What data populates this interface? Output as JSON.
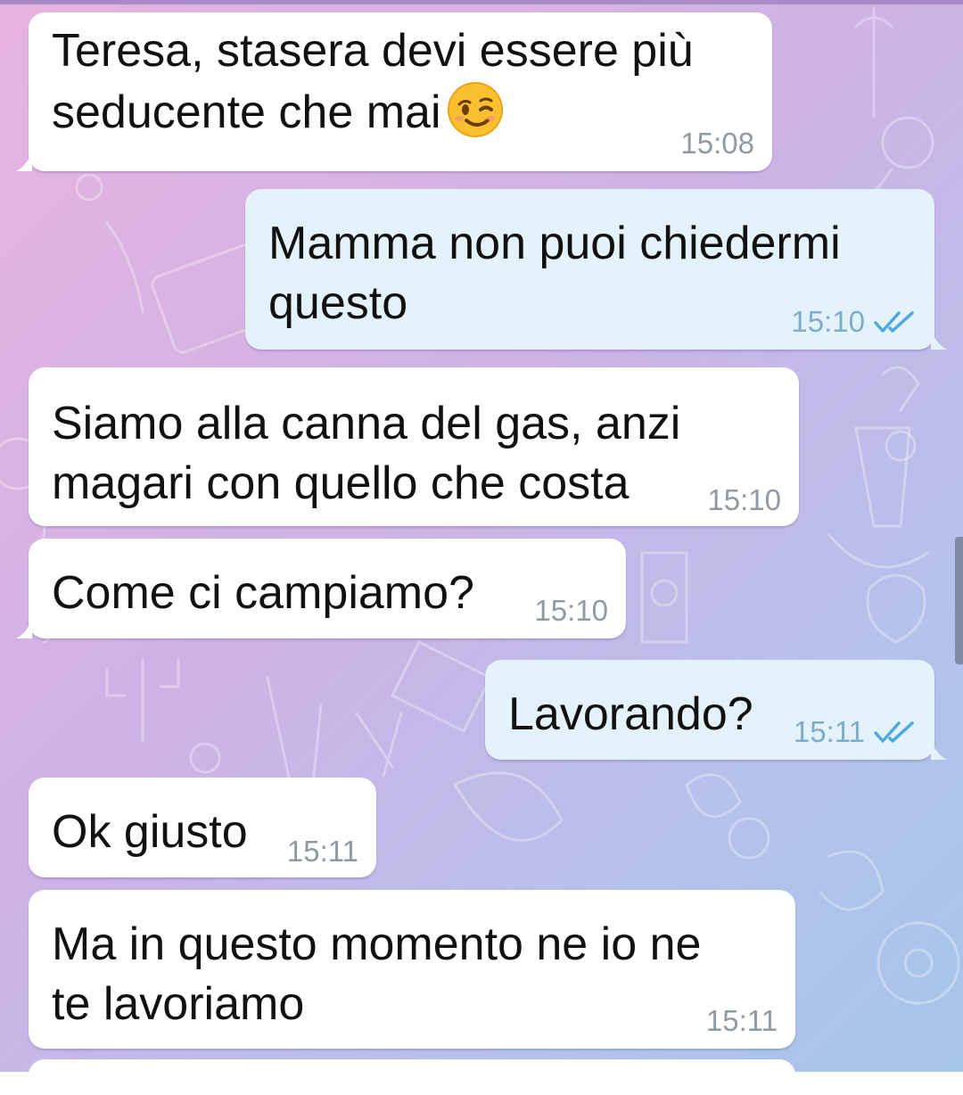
{
  "colors": {
    "incoming_bubble": "#ffffff",
    "outgoing_bubble": "#e4f3fb",
    "time_incoming": "#8f9aa3",
    "time_outgoing": "#7dadc8",
    "read_check": "#4fa8e0"
  },
  "messages": [
    {
      "text_lines": [
        "Teresa, stasera devi essere più",
        "seducente che mai"
      ],
      "emoji": "winking-face",
      "time": "15:08"
    },
    {
      "text_lines": [
        "Mamma non puoi chiedermi",
        "questo"
      ],
      "time": "15:10",
      "status": "double-check-read"
    },
    {
      "text_lines": [
        "Siamo alla canna del gas, anzi",
        "magari con quello che costa"
      ],
      "time": "15:10"
    },
    {
      "text_lines": [
        "Come ci campiamo?"
      ],
      "time": "15:10"
    },
    {
      "text_lines": [
        "Lavorando?"
      ],
      "time": "15:11",
      "status": "double-check-read"
    },
    {
      "text_lines": [
        "Ok giusto"
      ],
      "time": "15:11"
    },
    {
      "text_lines": [
        "Ma in questo momento ne io ne",
        "te lavoriamo"
      ],
      "time": "15:11"
    }
  ]
}
